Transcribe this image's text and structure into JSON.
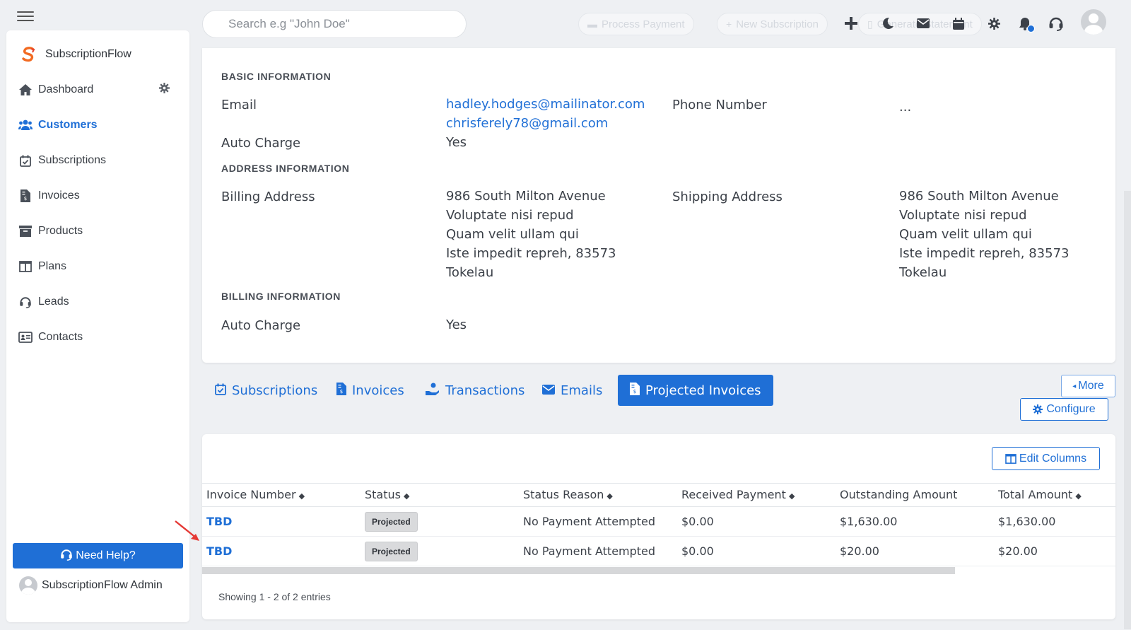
{
  "header": {
    "search_placeholder": "Search e.g \"John Doe\"",
    "ghost_buttons": {
      "process_payment": "Process Payment",
      "new_subscription": "New Subscription",
      "generate_statement": "Generate Statement"
    }
  },
  "sidebar": {
    "brand": "SubscriptionFlow",
    "items": [
      {
        "label": "Dashboard",
        "icon": "home-icon"
      },
      {
        "label": "Customers",
        "icon": "users-icon"
      },
      {
        "label": "Subscriptions",
        "icon": "calendar-check-icon"
      },
      {
        "label": "Invoices",
        "icon": "invoice-icon"
      },
      {
        "label": "Products",
        "icon": "archive-icon"
      },
      {
        "label": "Plans",
        "icon": "columns-icon"
      },
      {
        "label": "Leads",
        "icon": "headset-icon"
      },
      {
        "label": "Contacts",
        "icon": "id-card-icon"
      }
    ],
    "help_label": "Need Help?",
    "admin_name": "SubscriptionFlow Admin"
  },
  "basic": {
    "heading": "BASIC INFORMATION",
    "email_label": "Email",
    "email_1": "hadley.hodges@mailinator.com",
    "email_2": "chrisferely78@gmail.com",
    "phone_label": "Phone Number",
    "phone_value": "...",
    "auto_charge_label": "Auto Charge",
    "auto_charge_value": "Yes"
  },
  "address": {
    "heading": "ADDRESS INFORMATION",
    "billing_label": "Billing Address",
    "billing_lines": [
      "986 South Milton Avenue",
      "Voluptate nisi repud",
      "Quam velit ullam qui",
      "Iste impedit repreh, 83573",
      "Tokelau"
    ],
    "shipping_label": "Shipping Address",
    "shipping_lines": [
      "986 South Milton Avenue",
      "Voluptate nisi repud",
      "Quam velit ullam qui",
      "Iste impedit repreh, 83573",
      "Tokelau"
    ]
  },
  "billing": {
    "heading": "BILLING INFORMATION",
    "auto_charge_label": "Auto Charge",
    "auto_charge_value": "Yes"
  },
  "tabs": [
    {
      "label": "Subscriptions",
      "active": false
    },
    {
      "label": "Invoices",
      "active": false
    },
    {
      "label": "Transactions",
      "active": false
    },
    {
      "label": "Emails",
      "active": false
    },
    {
      "label": "Projected Invoices",
      "active": true
    }
  ],
  "actions": {
    "more": "More",
    "configure": "Configure",
    "edit_columns": "Edit Columns"
  },
  "table": {
    "columns": [
      "Invoice Number",
      "Status",
      "Status Reason",
      "Received Payment",
      "Outstanding Amount",
      "Total Amount"
    ],
    "rows": [
      [
        "TBD",
        "Projected",
        "No Payment Attempted",
        "$0.00",
        "$1,630.00",
        "$1,630.00"
      ],
      [
        "TBD",
        "Projected",
        "No Payment Attempted",
        "$0.00",
        "$20.00",
        "$20.00"
      ]
    ],
    "footer": "Showing 1 - 2 of 2 entries"
  },
  "colors": {
    "accent": "#1f6fd6",
    "badge_bg": "#d9dadc",
    "annotation_arrow": "#e53935"
  }
}
